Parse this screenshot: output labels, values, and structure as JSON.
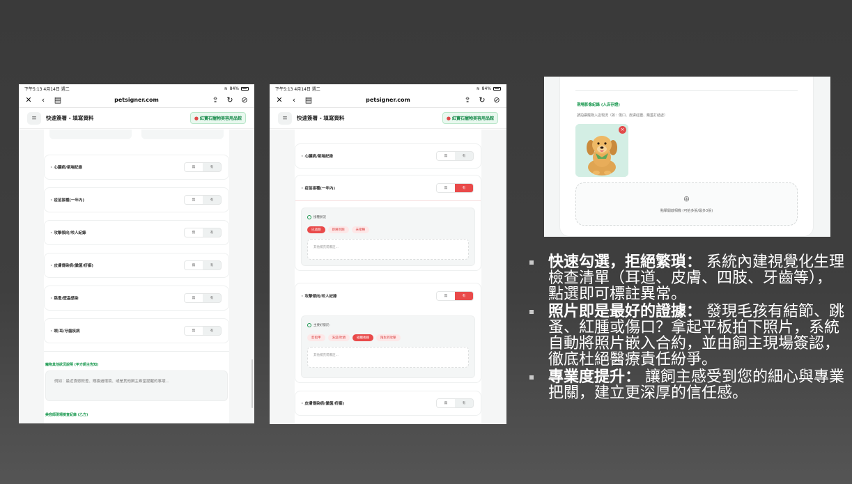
{
  "device": {
    "time": "下午5:13",
    "date": "4月14日 週二",
    "battery": "84%",
    "url": "petsigner.com"
  },
  "app": {
    "title": "快速簽署 - 填寫資料",
    "store": "紅寶石寵物美容用品館"
  },
  "toggle": {
    "no": "無",
    "yes": "有"
  },
  "screen1": {
    "rows": [
      "心臟病/氣喘紀錄",
      "疫苗接種(一年內)",
      "攻擊傾向/咬人紀錄",
      "皮膚傳染病(黴菌/疥癬)",
      "跳蚤/壁蝨感染",
      "眼/耳/牙齒疾病"
    ],
    "notes_label": "寵物其他狀況說明 (甲方飼主告知)",
    "notes_placeholder": "例如：最近食慾較差、剛換過環境、或是其他飼主希望提醒的事項...",
    "next_section": "美容師現場檢查紀錄 (乙方)"
  },
  "screen2": {
    "row1": "心臟病/氣喘紀錄",
    "row2": "疫苗接種(一年內)",
    "row2_sub": "接種狀況",
    "row2_chips": [
      "已過期",
      "即將到期",
      "未接種"
    ],
    "row2_input": "其他補充或備註...",
    "row3": "攻擊傾向/咬人紀錄",
    "row3_sub": "主要好發於：",
    "row3_chips": [
      "剪指甲",
      "洗澡/吹頭",
      "碰觸後腳",
      "陌生到攻擊"
    ],
    "row3_input": "其他補充或備註...",
    "row4": "皮膚傳染病(黴菌/疥癬)"
  },
  "screen3": {
    "title": "現場影像紀錄 (入店存證)",
    "subtitle": "請拍攝寵物入店現況（如：傷口、皮膚紅腫、藥蓋打結處）",
    "upload_text": "點擊開啟相機 (可拍多張/最多3張)"
  },
  "bullets": [
    {
      "head": "快速勾選，拒絕繁瑣：",
      "body": " 系統內建視覺化生理檢查清單（耳道、皮膚、四肢、牙齒等），點選即可標註異常。"
    },
    {
      "head": "照片即是最好的證據：",
      "body": " 發現毛孩有結節、跳蚤、紅腫或傷口？拿起平板拍下照片，系統自動將照片嵌入合約，並由飼主現場簽認，徹底杜絕醫療責任紛爭。"
    },
    {
      "head": "專業度提升：",
      "body": " 讓飼主感受到您的細心與專業把關，建立更深厚的信任感。"
    }
  ]
}
